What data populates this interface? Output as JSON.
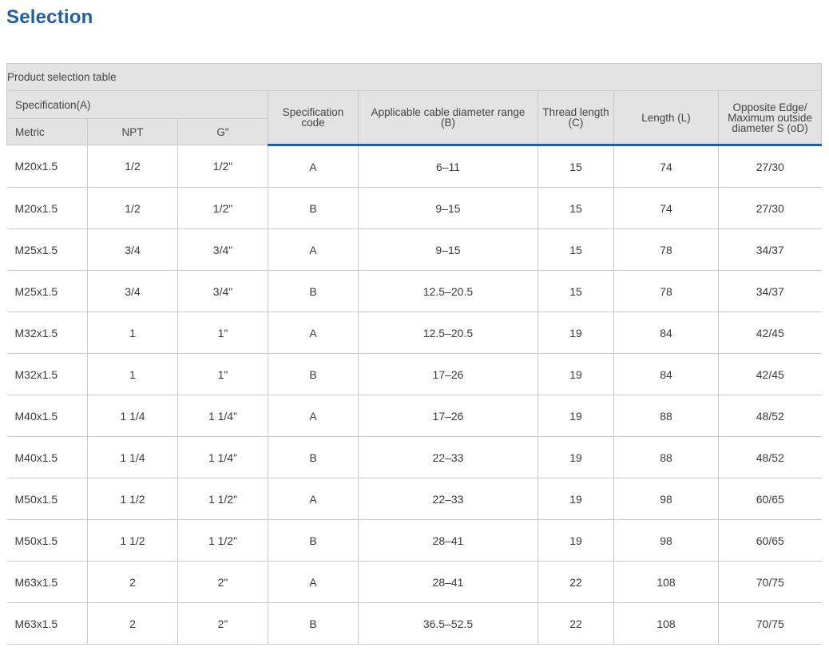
{
  "page": {
    "title": "Selection"
  },
  "table": {
    "caption": "Product selection table",
    "group_header": "Specification(A)",
    "sub_headers": {
      "metric": "Metric",
      "npt": "NPT",
      "g": "G\""
    },
    "headers": {
      "spec_code": [
        "Specification",
        "code"
      ],
      "cable_range": [
        "Applicable cable diameter range",
        "(B)"
      ],
      "thread_length": [
        "Thread length",
        "(C)"
      ],
      "length": "Length  (L)",
      "opposite_edge": [
        "Opposite Edge/",
        "Maximum outside",
        "diameter  S (oD)"
      ]
    },
    "rows": [
      [
        "M20x1.5",
        "1/2",
        "1/2\"",
        "A",
        "6–11",
        "15",
        "74",
        "27/30"
      ],
      [
        "M20x1.5",
        "1/2",
        "1/2\"",
        "B",
        "9–15",
        "15",
        "74",
        "27/30"
      ],
      [
        "M25x1.5",
        "3/4",
        "3/4\"",
        "A",
        "9–15",
        "15",
        "78",
        "34/37"
      ],
      [
        "M25x1.5",
        "3/4",
        "3/4\"",
        "B",
        "12.5–20.5",
        "15",
        "78",
        "34/37"
      ],
      [
        "M32x1.5",
        "1",
        "1\"",
        "A",
        "12.5–20.5",
        "19",
        "84",
        "42/45"
      ],
      [
        "M32x1.5",
        "1",
        "1\"",
        "B",
        "17–26",
        "19",
        "84",
        "42/45"
      ],
      [
        "M40x1.5",
        "1 1/4",
        "1 1/4\"",
        "A",
        "17–26",
        "19",
        "88",
        "48/52"
      ],
      [
        "M40x1.5",
        "1 1/4",
        "1 1/4\"",
        "B",
        "22–33",
        "19",
        "88",
        "48/52"
      ],
      [
        "M50x1.5",
        "1 1/2",
        "1 1/2\"",
        "A",
        "22–33",
        "19",
        "98",
        "60/65"
      ],
      [
        "M50x1.5",
        "1 1/2",
        "1 1/2\"",
        "B",
        "28–41",
        "19",
        "98",
        "60/65"
      ],
      [
        "M63x1.5",
        "2",
        "2\"",
        "A",
        "28–41",
        "22",
        "108",
        "70/75"
      ],
      [
        "M63x1.5",
        "2",
        "2\"",
        "B",
        "36.5–52.5",
        "22",
        "108",
        "70/75"
      ]
    ]
  },
  "colors": {
    "title": "#1f5fa6",
    "header_bg": "#e3e3e3",
    "accent_line": "#1f5fa6",
    "border": "#c9c9c9"
  }
}
